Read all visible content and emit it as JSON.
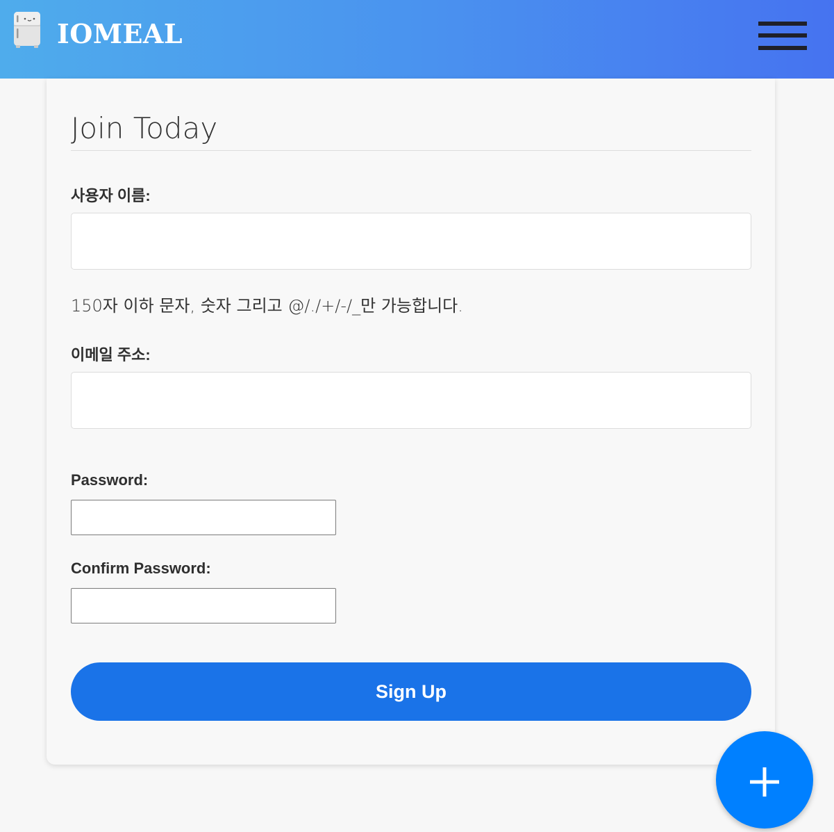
{
  "header": {
    "brand": "IOMEAL",
    "logo_icon": "fridge-icon",
    "menu_icon": "hamburger-menu-icon",
    "gradient": [
      "#4facec",
      "#4673f0"
    ]
  },
  "form": {
    "legend": "Join Today",
    "username_label": "사용자 이름:",
    "username_value": "",
    "username_help": "150자 이하 문자, 숫자 그리고 @/./+/-/_만 가능합니다.",
    "email_label": "이메일 주소:",
    "email_value": "",
    "password_label": "Password:",
    "password_value": "",
    "confirm_password_label": "Confirm Password:",
    "confirm_password_value": "",
    "submit_label": "Sign Up"
  },
  "fab": {
    "icon": "plus-icon",
    "color": "#0080ff"
  },
  "colors": {
    "primary_button": "#1a73e8",
    "background": "#f7f7f7"
  }
}
